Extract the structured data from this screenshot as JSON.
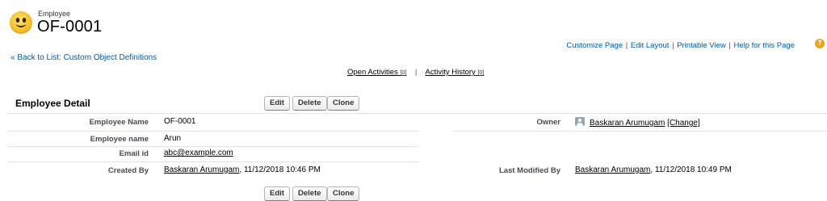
{
  "header": {
    "object_type": "Employee",
    "record_title": "OF-0001",
    "icon": "smiley-face-icon"
  },
  "top_links": {
    "customize": "Customize Page",
    "edit_layout": "Edit Layout",
    "printable": "Printable View",
    "help": "Help for this Page",
    "separator": "|",
    "help_icon_glyph": "?",
    "help_icon_color": "#e8a317"
  },
  "back_link": "« Back to List: Custom Object Definitions",
  "related": {
    "open_activities": "Open Activities",
    "open_activities_count": "[0]",
    "activity_history": "Activity History",
    "activity_history_count": "[0]",
    "separator": "|"
  },
  "detail": {
    "title": "Employee Detail",
    "buttons": {
      "edit": "Edit",
      "delete": "Delete",
      "clone": "Clone"
    },
    "fields": {
      "employee_name_label": "Employee Name",
      "employee_name_value": "OF-0001",
      "emp_name_label": "Employee name",
      "emp_name_value": "Arun",
      "email_label": "Email id",
      "email_value": "abc@example.com",
      "created_by_label": "Created By",
      "created_by_user": "Baskaran Arumugam",
      "created_by_date": ", 11/12/2018 10:46 PM",
      "owner_label": "Owner",
      "owner_value": "Baskaran Arumugam",
      "owner_change": "[Change]",
      "last_modified_label": "Last Modified By",
      "last_modified_user": "Baskaran Arumugam",
      "last_modified_date": ", 11/12/2018 10:49 PM"
    }
  },
  "colors": {
    "link_blue": "#015ba7",
    "label_gray": "#4a4a56",
    "divider": "#e3e3e3"
  }
}
